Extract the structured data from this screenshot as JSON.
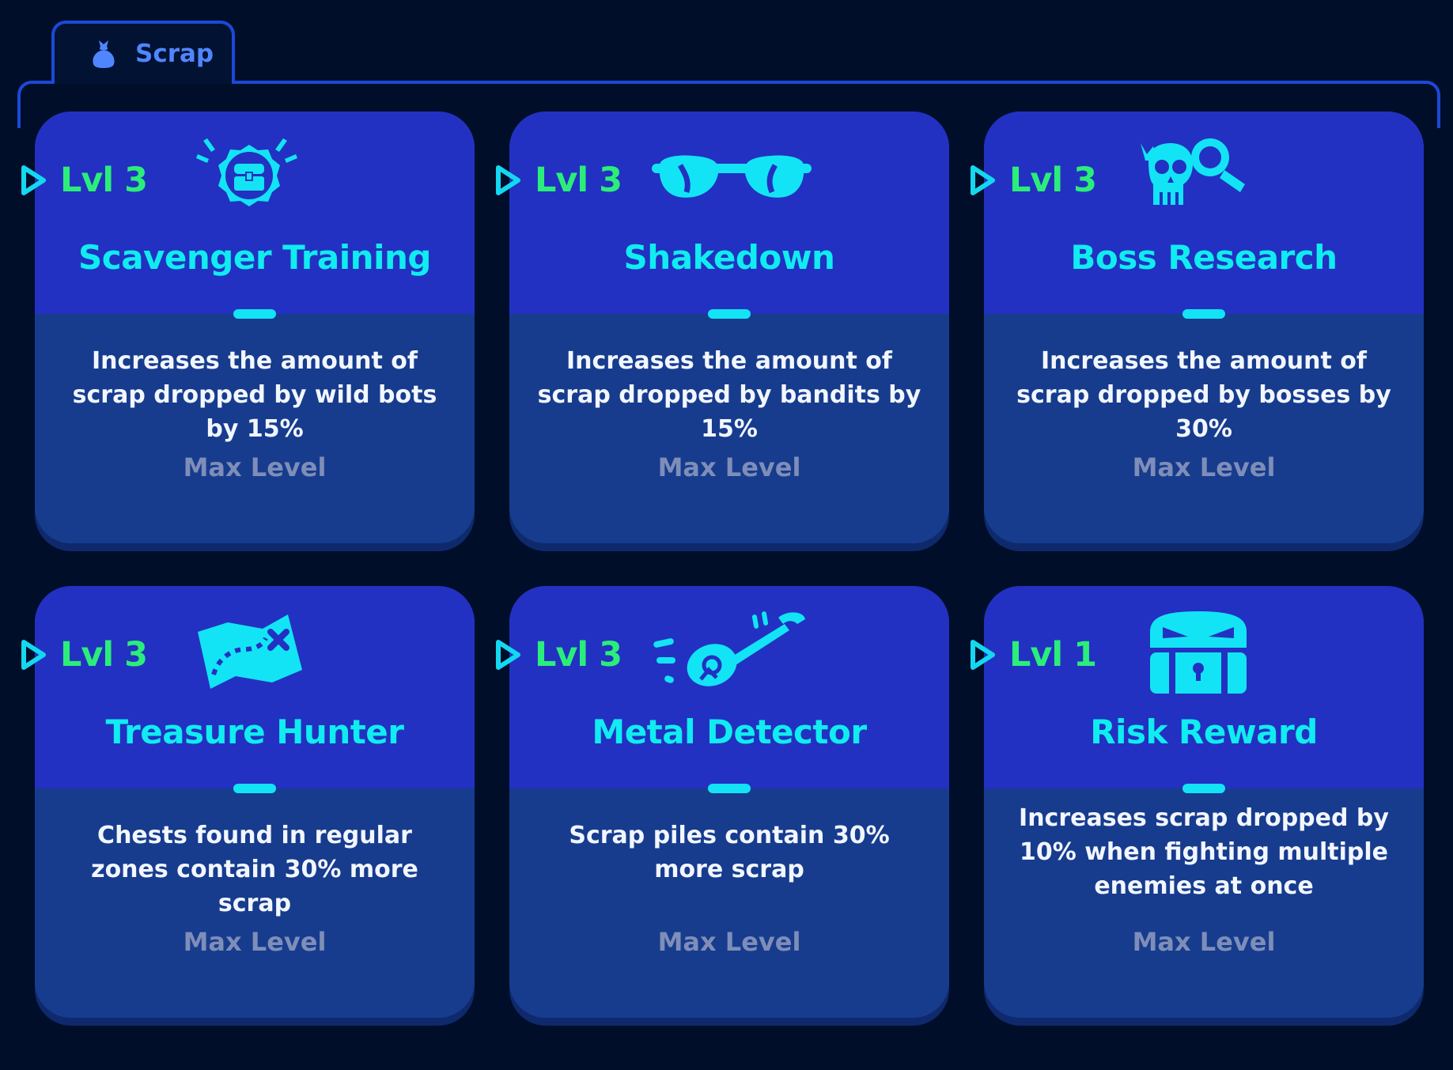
{
  "tab": {
    "label": "Scrap",
    "icon": "money-bag-icon"
  },
  "colors": {
    "background": "#000e2a",
    "accent_blue": "#1b4ad8",
    "card_top": "#2331c2",
    "card_bottom": "#173c8e",
    "level_green": "#2bee7a",
    "title_cyan": "#10ecf0",
    "status_gray": "#7e8eb8"
  },
  "cards": [
    {
      "level": "Lvl 3",
      "title": "Scavenger Training",
      "icon": "treasure-chest-badge-icon",
      "description": "Increases the amount of scrap dropped by wild bots by 15%",
      "status": "Max Level"
    },
    {
      "level": "Lvl 3",
      "title": "Shakedown",
      "icon": "sunglasses-icon",
      "description": "Increases the amount of scrap dropped by bandits by 15%",
      "status": "Max Level"
    },
    {
      "level": "Lvl 3",
      "title": "Boss Research",
      "icon": "skull-magnifier-icon",
      "description": "Increases the amount of scrap dropped by bosses by 30%",
      "status": "Max Level"
    },
    {
      "level": "Lvl 3",
      "title": "Treasure Hunter",
      "icon": "treasure-map-icon",
      "description": "Chests found in regular zones contain 30% more scrap",
      "status": "Max Level"
    },
    {
      "level": "Lvl 3",
      "title": "Metal Detector",
      "icon": "metal-detector-icon",
      "description": "Scrap piles contain 30% more scrap",
      "status": "Max Level"
    },
    {
      "level": "Lvl 1",
      "title": "Risk Reward",
      "icon": "angry-chest-icon",
      "description": "Increases scrap dropped by 10% when fighting multiple enemies at once",
      "status": "Max Level"
    }
  ]
}
